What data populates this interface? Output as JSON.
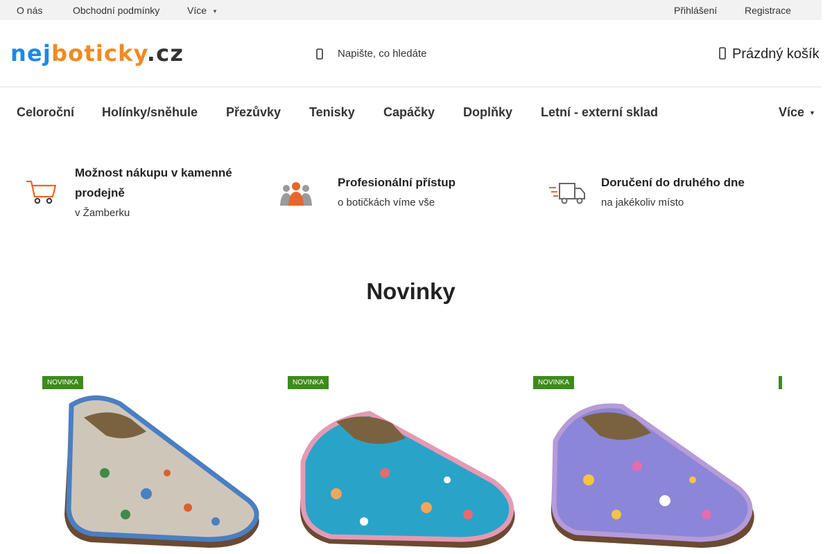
{
  "topbar": {
    "links": [
      "O nás",
      "Obchodní podmínky",
      "Více"
    ],
    "login": "Přihlášení",
    "register": "Registrace"
  },
  "logo": {
    "part1": "nej",
    "part2": "boticky",
    "part3": ".cz"
  },
  "search": {
    "placeholder": "Napište, co hledáte"
  },
  "cart": {
    "label": "Prázdný košík"
  },
  "nav": {
    "items": [
      "Celoroční",
      "Holínky/sněhule",
      "Přezůvky",
      "Tenisky",
      "Capáčky",
      "Doplňky",
      "Letní - externí sklad"
    ],
    "more": "Více"
  },
  "benefits": [
    {
      "title": "Možnost nákupu v kamenné prodejně",
      "subtitle": "v Žamberku",
      "icon": "shopping-cart-icon"
    },
    {
      "title": "Profesionální přístup",
      "subtitle": "o botičkách víme vše",
      "icon": "people-icon"
    },
    {
      "title": "Doručení do druhého dne",
      "subtitle": "na jakékoliv místo",
      "icon": "delivery-truck-icon"
    }
  ],
  "section": {
    "title": "Novinky"
  },
  "products": [
    {
      "badge": "NOVINKA",
      "trim": "#4a7fc1",
      "pattern_bg": "#cfc6ba",
      "pattern": "dinosaurs"
    },
    {
      "badge": "NOVINKA",
      "trim": "#e59ab4",
      "pattern_bg": "#2aa3c9",
      "pattern": "sea-animals"
    },
    {
      "badge": "NOVINKA",
      "trim": "#b69bd9",
      "pattern_bg": "#8c86d8",
      "pattern": "sweets"
    }
  ],
  "colors": {
    "badge": "#3d8b1c",
    "logo_blue": "#1e88e5",
    "logo_orange": "#f08a24",
    "icon_gray": "#888888",
    "icon_orange": "#e8662a"
  }
}
